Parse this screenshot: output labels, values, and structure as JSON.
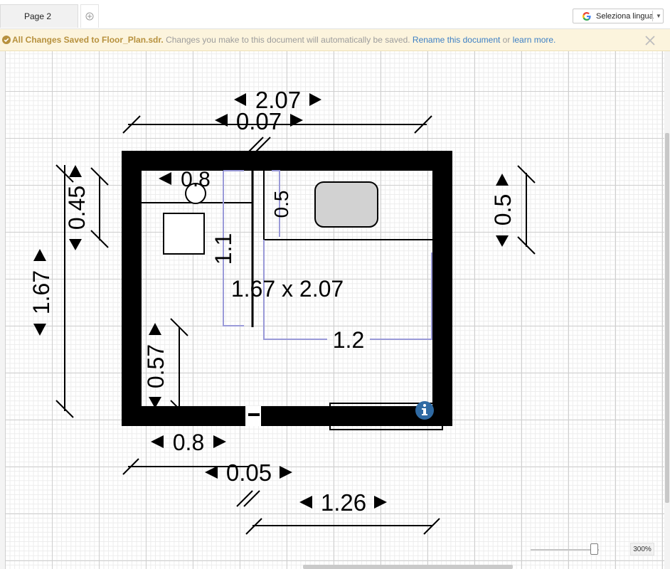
{
  "tabs": [
    {
      "label": "Page 2"
    }
  ],
  "translate": {
    "label": "Seleziona lingua"
  },
  "notice": {
    "saved": "All Changes Saved to Floor_Plan.sdr.",
    "message": "Changes you make to this document will automatically be saved.",
    "rename_link": "Rename this document",
    "or": "or",
    "learn_link": "learn more."
  },
  "plan": {
    "dims": {
      "top_outer": "2.07",
      "top_inner": "0.07",
      "left_outer": "1.67",
      "left_upper": "0.45",
      "right": "0.5",
      "inner_top": "0.8",
      "inner_vertical_a": "0.5",
      "inner_vertical_b": "1.1",
      "area": "1.67 x 2.07",
      "inner_width": "1.2",
      "left_lower": "0.57",
      "bottom_left": "0.8",
      "bottom_mid": "0.05",
      "bottom_right": "1.26"
    }
  },
  "zoom": {
    "level": "300%",
    "fraction": 0.93
  },
  "colors": {
    "notice_bg": "#fcf4dd",
    "saved_text": "#b7913e",
    "link": "#3c7fc4",
    "info_icon": "#2f6aa3",
    "guide": "#9a9ad8"
  }
}
